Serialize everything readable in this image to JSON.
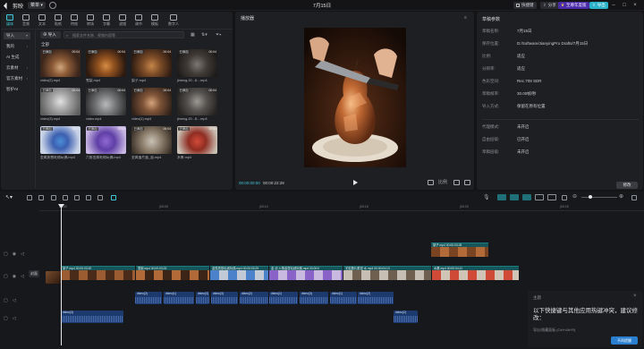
{
  "app": {
    "name": "剪映",
    "menu_label": "菜单",
    "title": "7月15日"
  },
  "topbar": {
    "shortcut_label": "快捷键",
    "share_label": "分享",
    "pro_label": "至尊年度版",
    "export_label": "导出"
  },
  "media_toolbar": [
    {
      "label": "媒体",
      "icon": "media-icon",
      "active": true
    },
    {
      "label": "音频",
      "icon": "audio-icon"
    },
    {
      "label": "文本",
      "icon": "text-icon"
    },
    {
      "label": "贴纸",
      "icon": "sticker-icon"
    },
    {
      "label": "特效",
      "icon": "effect-icon"
    },
    {
      "label": "转场",
      "icon": "transition-icon"
    },
    {
      "label": "字幕",
      "icon": "caption-icon"
    },
    {
      "label": "滤镜",
      "icon": "filter-icon"
    },
    {
      "label": "调节",
      "icon": "adjust-icon"
    },
    {
      "label": "模板",
      "icon": "template-icon"
    },
    {
      "label": "数字人",
      "icon": "avatar-icon"
    }
  ],
  "sidebar": [
    {
      "label": "导入",
      "selected": true,
      "chevron": "▾"
    },
    {
      "label": "我的",
      "chevron": "›"
    },
    {
      "label": "AI 生成",
      "chevron": ""
    },
    {
      "label": "云素材",
      "chevron": "›"
    },
    {
      "label": "官方素材",
      "chevron": "›"
    },
    {
      "label": "智护AI",
      "chevron": ""
    }
  ],
  "media": {
    "import_label": "导入",
    "search_placeholder": "搜索文件名称、视频内容等",
    "all_label": "全部",
    "clips": [
      {
        "name": "video(2).mp4",
        "added": "已添加",
        "duration": "00:04"
      },
      {
        "name": "雪梨.mp4",
        "added": "已添加",
        "duration": "00:04"
      },
      {
        "name": "梨子.mp4",
        "added": "已添加",
        "duration": "00:04"
      },
      {
        "name": "jimeng-20...8....mp4",
        "added": "已添加",
        "duration": "00:04"
      },
      {
        "name": "video(3).mp4",
        "added": "已添加",
        "duration": "00:04"
      },
      {
        "name": "video.mp4",
        "added": "已添加",
        "duration": "00:04"
      },
      {
        "name": "video(1).mp4",
        "added": "已添加",
        "duration": "00:04"
      },
      {
        "name": "jimeng-20...8....mp4",
        "added": "已添加",
        "duration": "00:04"
      },
      {
        "name": "金属质感毛绒玩偶.mp4",
        "added": "已添加",
        "duration": "00:04"
      },
      {
        "name": "六角金属毛绒玩偶.mp4",
        "added": "已添加",
        "duration": "00:04"
      },
      {
        "name": "金属蛋片蛋_面.mp4",
        "added": "已添加",
        "duration": "00:04"
      },
      {
        "name": "水果.mp4",
        "added": "已添加",
        "duration": "00:04"
      }
    ]
  },
  "player": {
    "title": "播放器",
    "current_time": "00:00:00:00",
    "total_time": "00:00:22:28"
  },
  "properties": {
    "title": "草稿参数",
    "rows": [
      {
        "key": "草稿名称:",
        "value": "7月15日"
      },
      {
        "key": "保存位置:",
        "value": "D:/Software/JianyingPro Drafts/7月15日"
      },
      {
        "key": "比例:",
        "value": "适应"
      },
      {
        "key": "分辨率:",
        "value": "适应"
      },
      {
        "key": "色彩空间:",
        "value": "Rec.709 SDR"
      },
      {
        "key": "草稿帧率:",
        "value": "30.00帧/秒"
      },
      {
        "key": "导入方式:",
        "value": "保留在原有位置"
      },
      {
        "key": "代理模式:",
        "value": "未开启"
      },
      {
        "key": "自由层级:",
        "value": "已开启"
      },
      {
        "key": "草稿层级:",
        "value": "未开启"
      }
    ],
    "modify_label": "修改"
  },
  "timeline": {
    "ruler_ticks": [
      "00:00",
      "|00:05",
      "|00:10",
      "|00:15",
      "|00:20",
      "|00:25"
    ],
    "main_clips": [
      {
        "label": "梨子.mp4  00:00:03:20"
      },
      {
        "label": "雪梨.mp4  00:00:03:23"
      },
      {
        "label": "金属质感毛绒玩偶.mp4  00:00:03:29"
      },
      {
        "label": "金 滤 六角金属毛绒玩偶.mp4  00:00:0"
      },
      {
        "label": "无铝蛋片蛋钮 水 mp4  00:00:04:13"
      },
      {
        "label": "水果.mp4  00:00:04:11"
      }
    ],
    "overlay_clip": "梨子.mp4  00:00:03:28",
    "audio_clips": [
      "video(2)",
      "video(1)",
      "video(3)",
      "video(3)",
      "video(2)",
      "video(1)",
      "video(3)",
      "video(1)",
      "video(2)"
    ],
    "audio2_clips": [
      "video(3)",
      "video(2)"
    ]
  },
  "toast": {
    "title": "主题",
    "message": "以下快捷键与其他应用热键冲突，建议修改：",
    "hint": "导出/隐藏面板 (Ctrl+Alt+R)",
    "button": "不再提醒"
  }
}
